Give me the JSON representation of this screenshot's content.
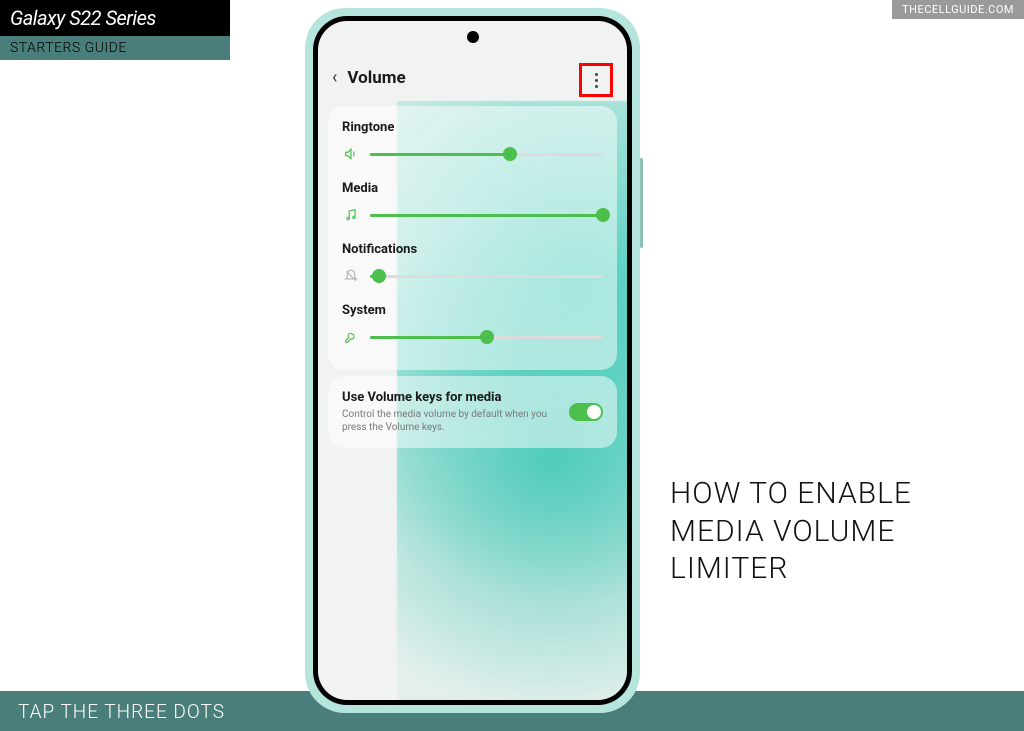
{
  "branding": {
    "top": "Galaxy S22 Series",
    "bottom": "STARTERS GUIDE"
  },
  "watermark": "THECELLGUIDE.COM",
  "headline": "HOW TO ENABLE MEDIA VOLUME LIMITER",
  "instruction": "TAP THE THREE DOTS",
  "screen": {
    "header": {
      "title": "Volume"
    },
    "sliders": [
      {
        "label": "Ringtone",
        "value": 60,
        "icon": "volume",
        "active": true
      },
      {
        "label": "Media",
        "value": 100,
        "icon": "music",
        "active": true
      },
      {
        "label": "Notifications",
        "value": 4,
        "icon": "bell",
        "active": false
      },
      {
        "label": "System",
        "value": 50,
        "icon": "wrench",
        "active": true
      }
    ],
    "toggle": {
      "title": "Use Volume keys for media",
      "desc": "Control the media volume by default when you press the Volume keys.",
      "on": true
    }
  }
}
